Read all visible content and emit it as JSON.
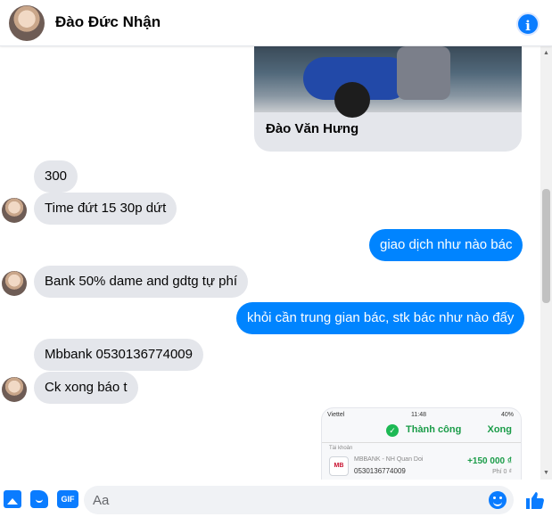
{
  "header": {
    "contact_name": "Đào Đức Nhận",
    "info_icon": "info-icon"
  },
  "shared_card": {
    "caption": "Đào Văn Hưng"
  },
  "messages": [
    {
      "direction": "incoming",
      "text": "300"
    },
    {
      "direction": "incoming",
      "text": "Time đứt 15 30p dứt"
    },
    {
      "direction": "outgoing",
      "text": "giao dịch như nào bác"
    },
    {
      "direction": "incoming",
      "text": "Bank 50% dame and gdtg tự phí"
    },
    {
      "direction": "outgoing",
      "text": "khỏi cần trung gian bác, stk bác như nào đấy"
    },
    {
      "direction": "incoming",
      "text": "Mbbank 0530136774009"
    },
    {
      "direction": "incoming",
      "text": "Ck xong báo t"
    }
  ],
  "receipt": {
    "carrier": "Viettel",
    "time": "11:48",
    "battery": "40%",
    "status": "Thành công",
    "done_label": "Xong",
    "from_label": "Tài khoản",
    "bank_logo": "MB",
    "bank": "MBBANK - NH Quan Doi",
    "account": "0530136774009",
    "amount": "+150 000 ₫",
    "fee": "Phí 0 ₫"
  },
  "composer": {
    "placeholder": "Aa",
    "gif_label": "GIF"
  },
  "colors": {
    "accent": "#0084ff",
    "incoming_bubble": "#e4e6eb",
    "success_green": "#1a9c48"
  }
}
